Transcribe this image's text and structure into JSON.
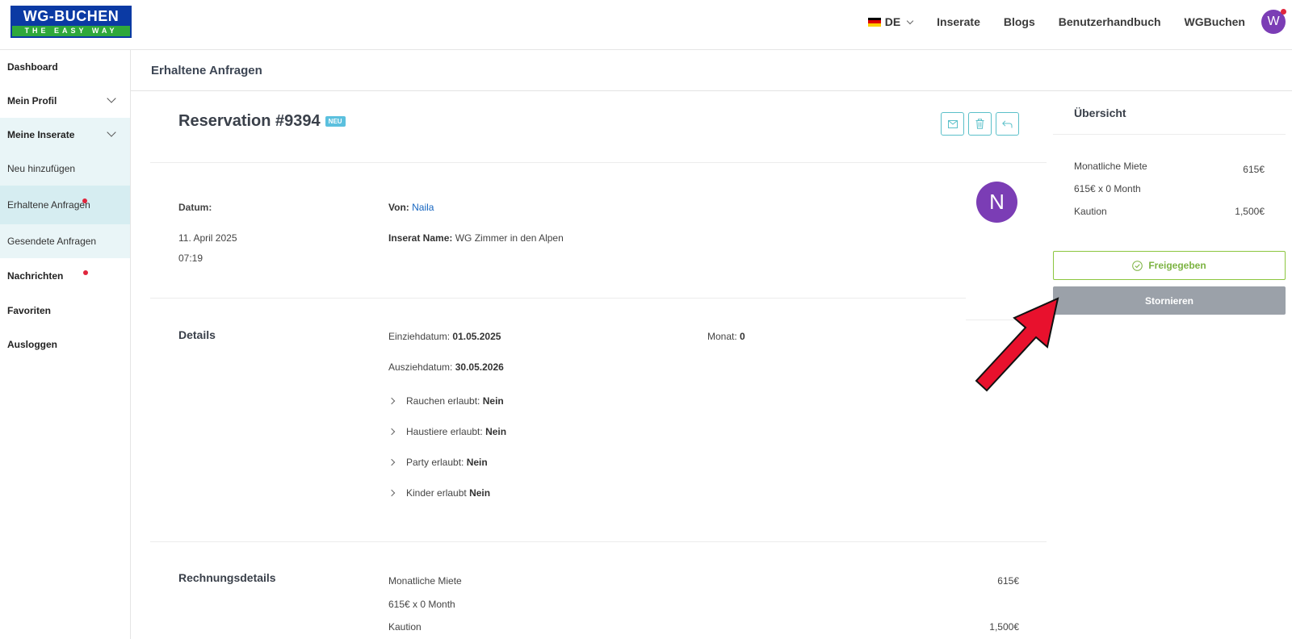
{
  "header": {
    "logo_top": "WG-BUCHEN",
    "logo_bottom": "THE EASY WAY",
    "language": "DE",
    "nav": [
      "Inserate",
      "Blogs",
      "Benutzerhandbuch",
      "WGBuchen"
    ],
    "user_initial": "W"
  },
  "sidebar": {
    "items": [
      {
        "label": "Dashboard"
      },
      {
        "label": "Mein Profil"
      },
      {
        "label": "Meine Inserate"
      },
      {
        "label": "Neu hinzufügen"
      },
      {
        "label": "Erhaltene Anfragen"
      },
      {
        "label": "Gesendete Anfragen"
      },
      {
        "label": "Nachrichten"
      },
      {
        "label": "Favoriten"
      },
      {
        "label": "Ausloggen"
      }
    ]
  },
  "page": {
    "title": "Erhaltene Anfragen"
  },
  "reservation": {
    "title": "Reservation #9394",
    "badge": "NEU",
    "date_label": "Datum:",
    "date": "11. April 2025",
    "time": "07:19",
    "from_label": "Von:",
    "from_name": "Naila",
    "listing_label": "Inserat Name:",
    "listing_name": "WG Zimmer in den Alpen",
    "avatar_initial": "N"
  },
  "details": {
    "title": "Details",
    "move_in_label": "Einziehdatum:",
    "move_in": "01.05.2025",
    "month_label": "Monat:",
    "month": "0",
    "move_out_label": "Ausziehdatum:",
    "move_out": "30.05.2026",
    "rules": [
      {
        "label": "Rauchen erlaubt:",
        "value": "Nein"
      },
      {
        "label": "Haustiere erlaubt:",
        "value": "Nein"
      },
      {
        "label": "Party erlaubt:",
        "value": "Nein"
      },
      {
        "label": "Kinder erlaubt",
        "value": "Nein"
      }
    ]
  },
  "invoice": {
    "title": "Rechnungsdetails",
    "monthly_rent_label": "Monatliche Miete",
    "monthly_rent": "615€",
    "calc": "615€ x 0 Month",
    "deposit_label": "Kaution",
    "deposit": "1,500€"
  },
  "overview": {
    "title": "Übersicht",
    "monthly_rent_label": "Monatliche Miete",
    "monthly_rent": "615€",
    "calc": "615€ x 0 Month",
    "deposit_label": "Kaution",
    "deposit": "1,500€",
    "approved_label": "Freigegeben",
    "cancel_label": "Stornieren"
  },
  "colors": {
    "accent": "#5bc0c9",
    "avatar": "#7b3db5",
    "approved": "#7cb342",
    "cancel": "#9ba1a9",
    "notification": "#e0263c",
    "arrow": "#e8112d"
  }
}
